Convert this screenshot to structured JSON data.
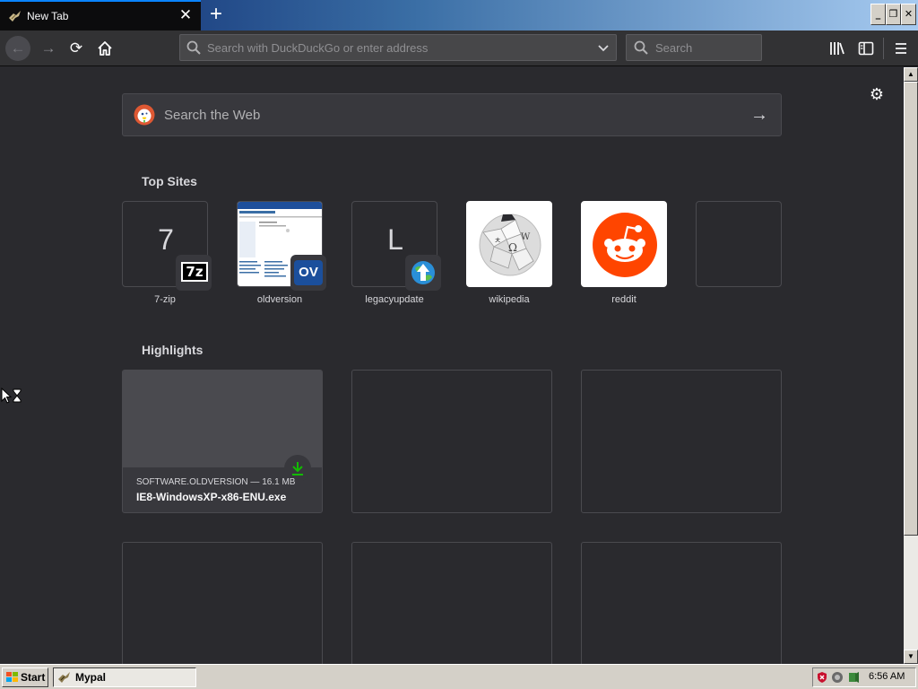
{
  "tab": {
    "title": "New Tab",
    "close": "✕"
  },
  "newtab": "+",
  "window_buttons": {
    "minimize": "_",
    "restore": "❐",
    "close": "✕"
  },
  "nav": {
    "back": "←",
    "forward": "→",
    "reload": "⟳",
    "home": "⌂",
    "url_placeholder": "Search with DuckDuckGo or enter address",
    "search_placeholder": "Search"
  },
  "content": {
    "settings_icon": "⚙",
    "websearch_placeholder": "Search the Web",
    "websearch_go": "→",
    "top_sites_title": "Top Sites",
    "top_sites": [
      {
        "label": "7-zip",
        "letter": "7",
        "badge": "7z"
      },
      {
        "label": "oldversion",
        "badge": "OV"
      },
      {
        "label": "legacyupdate",
        "letter": "L"
      },
      {
        "label": "wikipedia"
      },
      {
        "label": "reddit"
      },
      {
        "label": ""
      }
    ],
    "highlights_title": "Highlights",
    "highlight": {
      "host": "SOFTWARE.OLDVERSION — 16.1 MB",
      "title": "IE8-WindowsXP-x86-ENU.exe"
    }
  },
  "taskbar": {
    "start": "Start",
    "task": "Mypal",
    "clock": "6:56 AM"
  },
  "colors": {
    "accent": "#0a84ff",
    "bg": "#2a2a2e",
    "toolbar": "#323234",
    "download_green": "#12bc00",
    "reddit": "#ff4500"
  }
}
